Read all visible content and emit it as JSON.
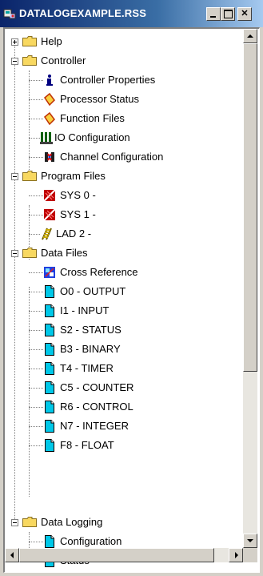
{
  "window": {
    "title": "DATALOGEXAMPLE.RSS",
    "controls": [
      "minimize",
      "maximize",
      "close"
    ]
  },
  "colors": {
    "titlebar_start": "#0a246a",
    "titlebar_end": "#a6caf0",
    "folder_yellow": "#f8d860",
    "data_file_cyan": "#00c8e8"
  },
  "tree": {
    "folders": {
      "help": {
        "label": "Help",
        "expanded": false
      },
      "controller": {
        "label": "Controller",
        "expanded": true
      },
      "program_files": {
        "label": "Program Files",
        "expanded": true
      },
      "data_files": {
        "label": "Data Files",
        "expanded": true
      },
      "data_logging": {
        "label": "Data Logging",
        "expanded": true
      }
    },
    "controller_items": [
      {
        "label": "Controller Properties",
        "icon": "info-icon"
      },
      {
        "label": "Processor Status",
        "icon": "processor-status-icon"
      },
      {
        "label": "Function Files",
        "icon": "function-files-icon"
      },
      {
        "label": "IO Configuration",
        "icon": "io-config-icon"
      },
      {
        "label": "Channel Configuration",
        "icon": "channel-config-icon"
      }
    ],
    "program_items": [
      {
        "label": "SYS 0 -",
        "icon": "system-program-icon"
      },
      {
        "label": "SYS 1 -",
        "icon": "system-program-icon"
      },
      {
        "label": "LAD 2 -",
        "icon": "ladder-program-icon"
      }
    ],
    "data_items": [
      {
        "label": "Cross Reference",
        "icon": "cross-reference-icon"
      },
      {
        "label": "O0 - OUTPUT",
        "icon": "data-file-icon"
      },
      {
        "label": "I1 - INPUT",
        "icon": "data-file-icon"
      },
      {
        "label": "S2 - STATUS",
        "icon": "data-file-icon"
      },
      {
        "label": "B3 - BINARY",
        "icon": "data-file-icon"
      },
      {
        "label": "T4 - TIMER",
        "icon": "data-file-icon"
      },
      {
        "label": "C5 - COUNTER",
        "icon": "data-file-icon"
      },
      {
        "label": "R6 - CONTROL",
        "icon": "data-file-icon"
      },
      {
        "label": "N7 - INTEGER",
        "icon": "data-file-icon"
      },
      {
        "label": "F8 - FLOAT",
        "icon": "data-file-icon"
      }
    ],
    "logging_items": [
      {
        "label": "Configuration",
        "icon": "data-file-icon"
      },
      {
        "label": "Status",
        "icon": "data-file-icon"
      }
    ]
  }
}
